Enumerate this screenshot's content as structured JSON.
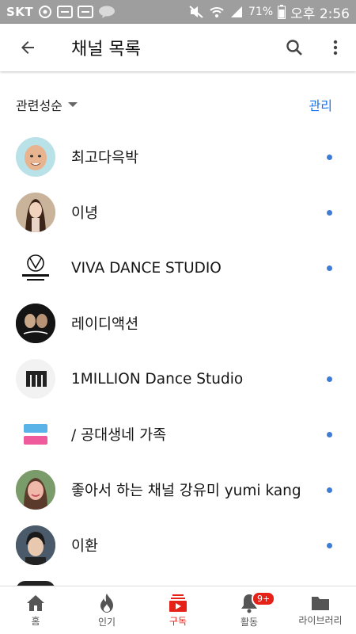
{
  "status_bar": {
    "carrier": "SKT",
    "battery": "71%",
    "time": "오후 2:56"
  },
  "app_bar": {
    "title": "채널 목록",
    "back_icon": "arrow-back-icon",
    "search_icon": "search-icon",
    "more_icon": "more-vert-icon"
  },
  "sort": {
    "label": "관련성순",
    "manage_label": "관리"
  },
  "channels": [
    {
      "name": "최고다윽박",
      "has_new": true,
      "avatar_color": "#b9e1e8"
    },
    {
      "name": "이녕",
      "has_new": true,
      "avatar_color": "#6b4f3d"
    },
    {
      "name": "VIVA DANCE STUDIO",
      "has_new": true,
      "avatar_color": "#ffffff"
    },
    {
      "name": "레이디액션",
      "has_new": false,
      "avatar_color": "#141414"
    },
    {
      "name": "1MILLION Dance Studio",
      "has_new": true,
      "avatar_color": "#f2f2f2"
    },
    {
      "name": "/ 공대생네 가족",
      "has_new": true,
      "avatar_color": "#ffffff"
    },
    {
      "name": "좋아서 하는 채널 강유미 yumi kang",
      "has_new": true,
      "avatar_color": "#c48f7a"
    },
    {
      "name": "이환",
      "has_new": true,
      "avatar_color": "#2f3a4a"
    }
  ],
  "bottom_nav": [
    {
      "label": "홈",
      "icon": "home-icon"
    },
    {
      "label": "인기",
      "icon": "trending-fire-icon"
    },
    {
      "label": "구독",
      "icon": "subscriptions-icon",
      "active": true
    },
    {
      "label": "활동",
      "icon": "bell-icon",
      "badge": "9+"
    },
    {
      "label": "라이브러리",
      "icon": "folder-icon"
    }
  ],
  "colors": {
    "accent_red": "#e62117",
    "link_blue": "#1a73e8",
    "dot_blue": "#3d7dd6"
  }
}
